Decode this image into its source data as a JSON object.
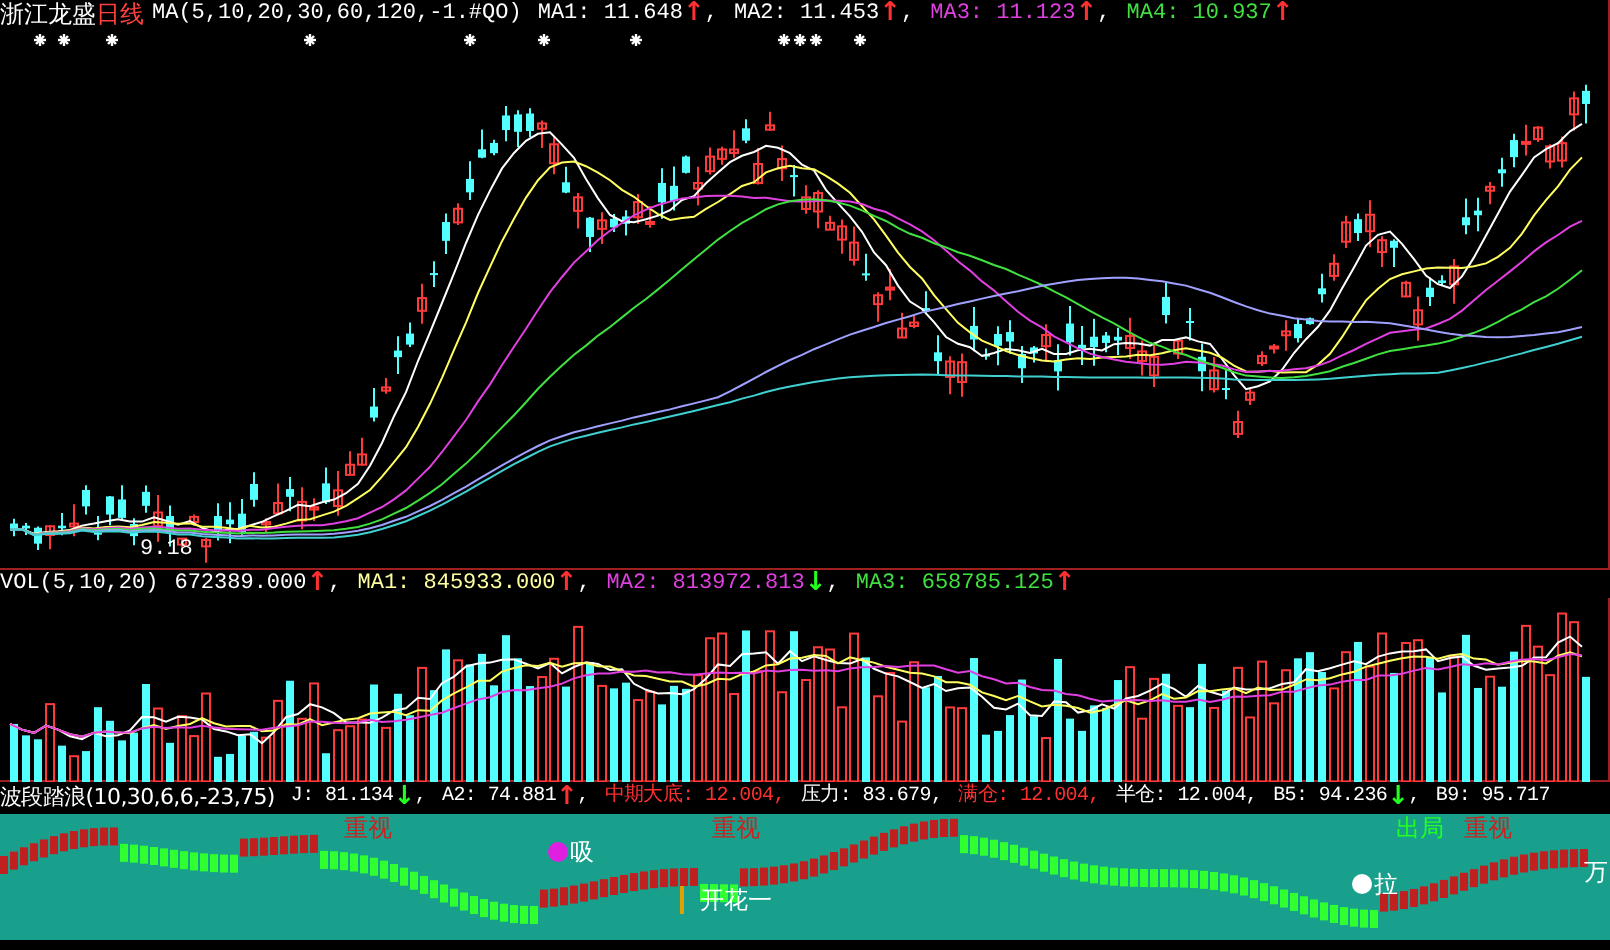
{
  "main_panel": {
    "stock_name": "浙江龙盛",
    "period": "日线",
    "indicator": "MA(5,10,20,30,60,120,-1.#QO)",
    "readouts": [
      {
        "text": "MA1: 11.648",
        "arrow": {
          "text": "↑",
          "color": "#ff3030"
        },
        "sep": ",",
        "color": "#ffffff"
      },
      {
        "text": "MA2: 11.453",
        "arrow": {
          "text": "↑",
          "color": "#ff3030"
        },
        "sep": ",",
        "color": "#ffffff"
      },
      {
        "text": "MA3: 11.123",
        "arrow": {
          "text": "↑",
          "color": "#ff3030"
        },
        "sep": ",",
        "color": "#e040e0"
      },
      {
        "text": "MA4: 10.937",
        "arrow": {
          "text": "↑",
          "color": "#ff3030"
        },
        "color": "#40e040"
      }
    ],
    "low_label": "9.18"
  },
  "volume_panel": {
    "indicator": "VOL(5,10,20)",
    "readouts": [
      {
        "text": "672389.000",
        "arrow": {
          "text": "↑",
          "color": "#ff3030"
        },
        "sep": ",",
        "color": "#ffffff"
      },
      {
        "text": "MA1: 845933.000",
        "arrow": {
          "text": "↑",
          "color": "#ff3030"
        },
        "sep": ",",
        "color": "#ffffa0"
      },
      {
        "text": "MA2: 813972.813",
        "arrow": {
          "text": "↓",
          "color": "#20ff20"
        },
        "sep": ",",
        "color": "#e040e0"
      },
      {
        "text": "MA3: 658785.125",
        "arrow": {
          "text": "↑",
          "color": "#ff3030"
        },
        "color": "#40e040"
      }
    ]
  },
  "wave_panel": {
    "indicator": "波段踏浪(10,30,6,6,-23,75)",
    "readouts": [
      {
        "text": "J: 81.134",
        "arrow": {
          "text": "↓",
          "color": "#20ff20"
        },
        "sep": ",",
        "color": "#ffffff"
      },
      {
        "text": "A2: 74.881",
        "arrow": {
          "text": "↑",
          "color": "#ff3030"
        },
        "sep": ",",
        "color": "#ffffff"
      },
      {
        "text": "中期大底: 12.004,",
        "color": "#ff3030"
      },
      {
        "text": "压力: 83.679,",
        "color": "#ffffff"
      },
      {
        "text": "满仓: 12.004,",
        "color": "#ff3030"
      },
      {
        "text": "半仓: 12.004,",
        "color": "#ffffff"
      },
      {
        "text": "B5: 94.236",
        "arrow": {
          "text": "↓",
          "color": "#20ff20"
        },
        "sep": ",",
        "color": "#ffffff"
      },
      {
        "text": "B9: 95.717",
        "color": "#ffffff"
      }
    ],
    "signals": [
      {
        "kind": "text",
        "text": "重视",
        "color": "#d02020"
      },
      {
        "kind": "dot",
        "text": "吸",
        "color": "#e020e0"
      },
      {
        "kind": "text",
        "text": "重视",
        "color": "#d02020"
      },
      {
        "kind": "cross",
        "text": "开花一",
        "color": "#ffffff"
      },
      {
        "kind": "dot",
        "text": "拉",
        "color": "#ffffff"
      },
      {
        "kind": "text",
        "text": "出局",
        "color": "#20ff20"
      },
      {
        "kind": "text",
        "text": "重视",
        "color": "#d02020"
      },
      {
        "kind": "text",
        "text": "万",
        "color": "#ffffff"
      }
    ]
  }
}
